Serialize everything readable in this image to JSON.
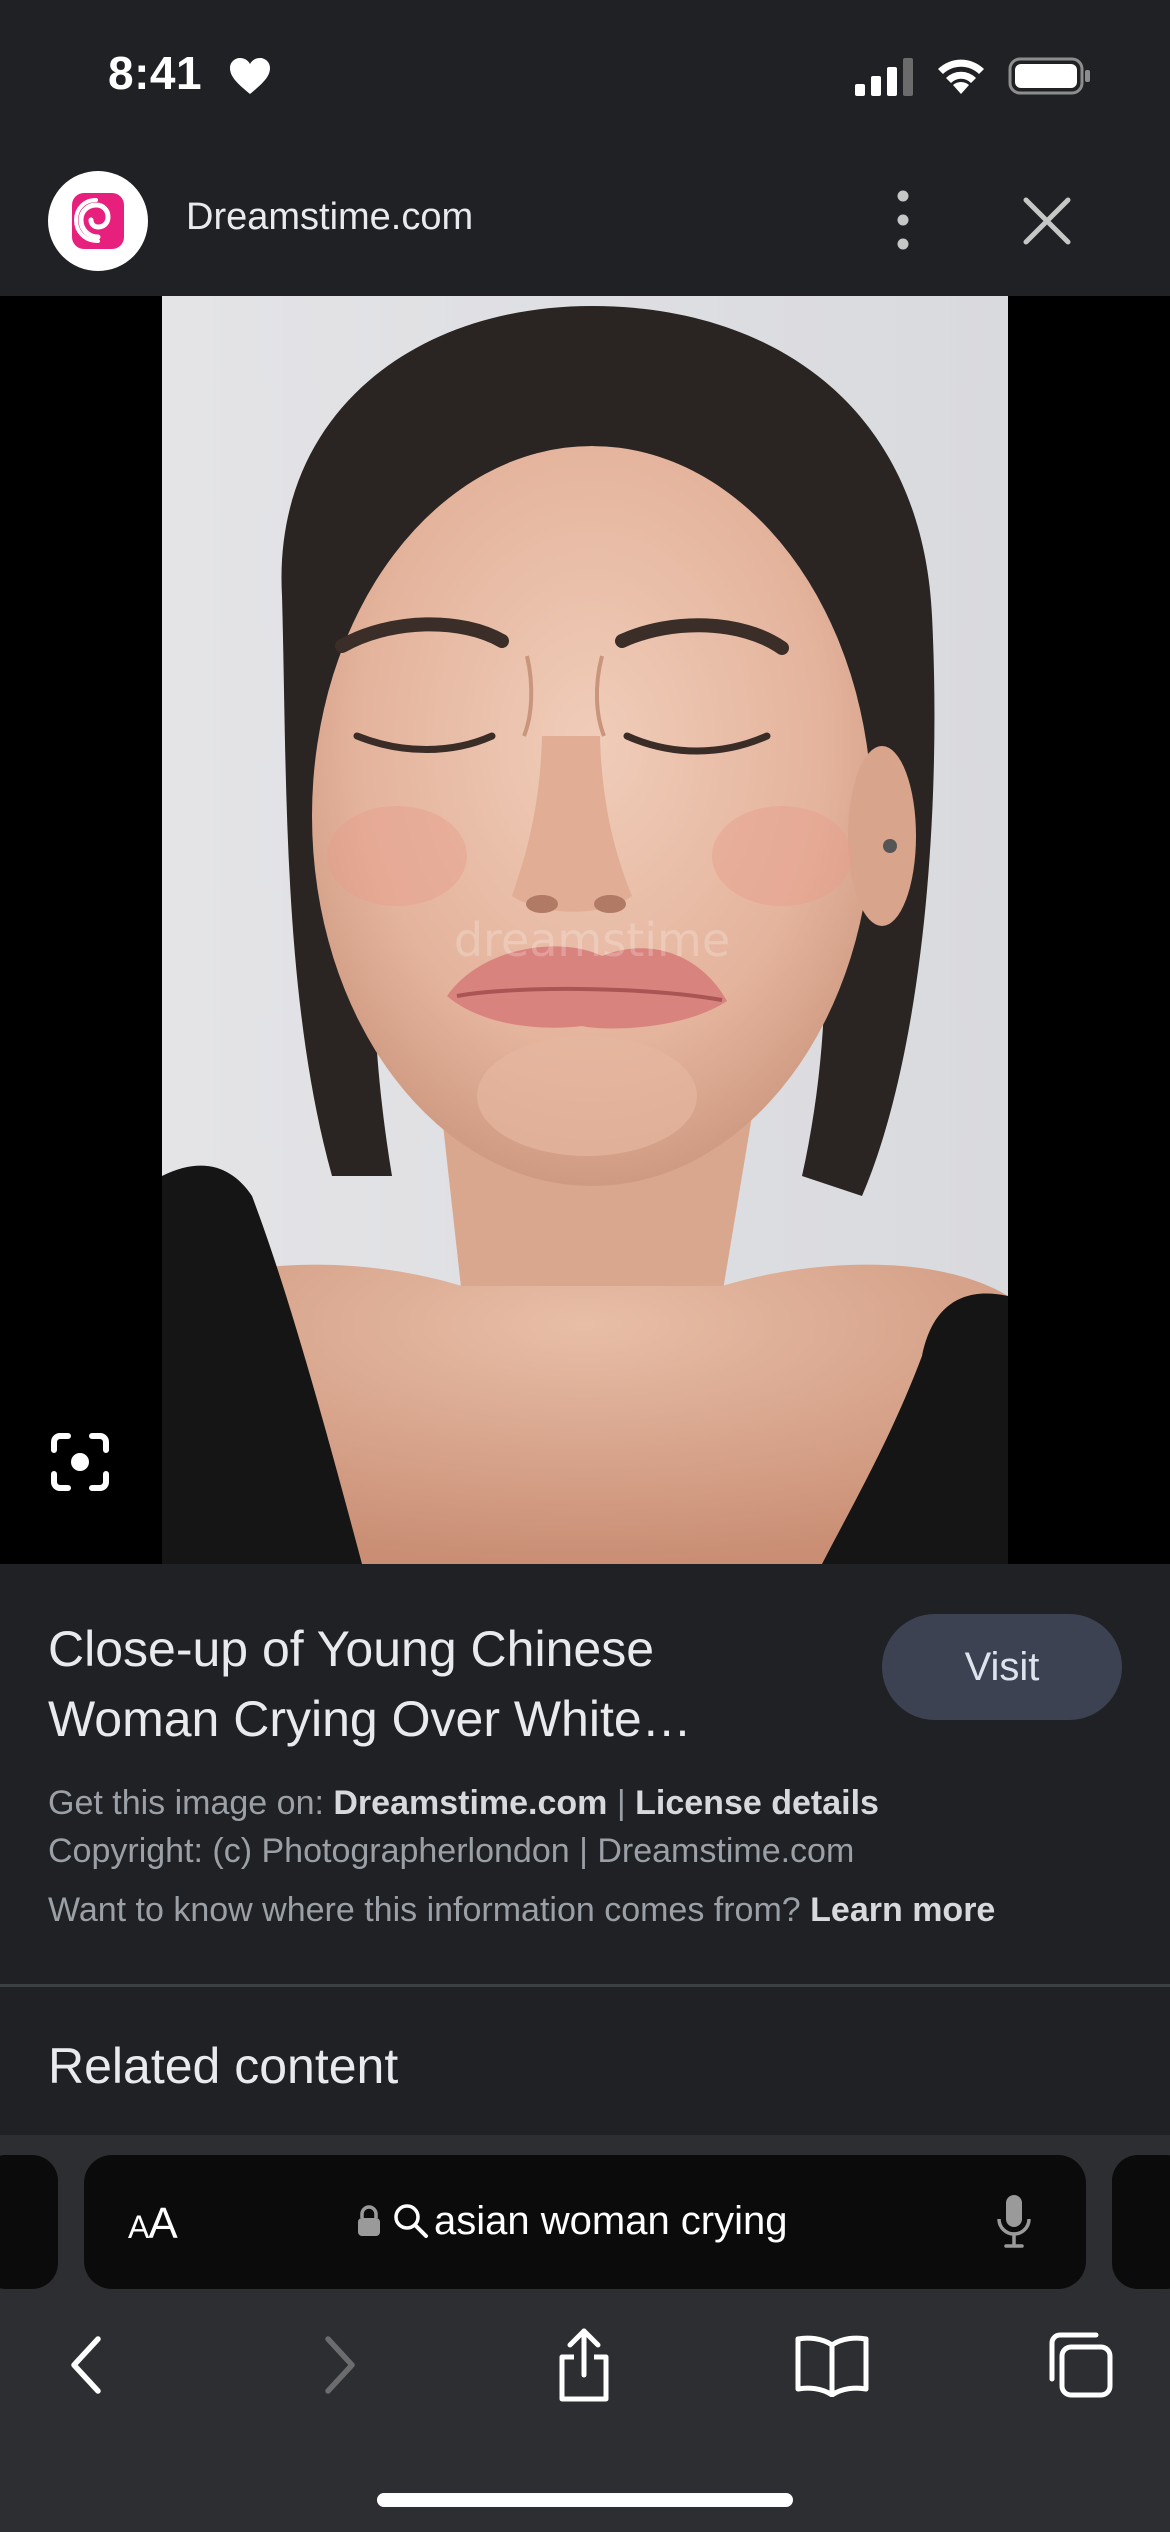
{
  "status_bar": {
    "time": "8:41",
    "icons": [
      "heart-icon",
      "cellular-signal-icon",
      "wifi-icon",
      "battery-icon"
    ]
  },
  "header": {
    "site_name": "Dreamstime.com",
    "logo_icon": "dreamstime-logo-icon",
    "more_icon": "more-vertical-icon",
    "close_icon": "close-icon"
  },
  "viewer": {
    "lens_icon": "google-lens-icon",
    "watermark": "dreamstime"
  },
  "info": {
    "title_line1": "Close-up of Young Chinese",
    "title_line2": "Woman Crying Over White…",
    "visit_label": "Visit",
    "get_image_prefix": "Get this image on:",
    "get_image_site": "Dreamstime.com",
    "separator": "|",
    "license_details": "License details",
    "copyright": "Copyright: (c) Photographerlondon | Dreamstime.com",
    "want_to_know": "Want to know where this information comes from?",
    "learn_more": "Learn more"
  },
  "related": {
    "title": "Related content"
  },
  "address_bar": {
    "aa_small": "A",
    "aa_large": "A",
    "query": "asian woman crying",
    "icons": [
      "lock-icon",
      "search-icon",
      "microphone-icon"
    ]
  },
  "toolbar": {
    "icons": [
      "back-icon",
      "forward-icon",
      "share-icon",
      "bookmarks-icon",
      "tabs-icon"
    ]
  },
  "colors": {
    "background": "#202124",
    "toolbar": "#2d2e31",
    "visit_button": "#3c4252",
    "logo_pink": "#e6207c"
  }
}
